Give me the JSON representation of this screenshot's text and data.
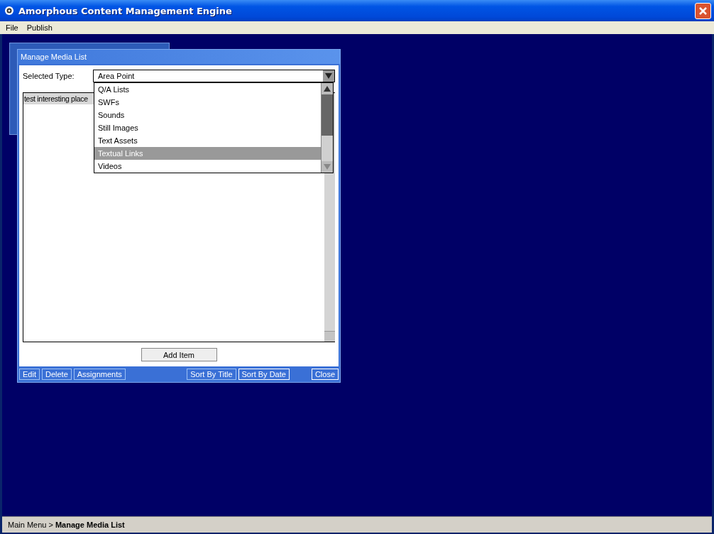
{
  "window": {
    "title": "Amorphous Content Management Engine"
  },
  "menu": [
    "File",
    "Publish"
  ],
  "background_window": {
    "kind": "window"
  },
  "dialog": {
    "title": "Manage Media List",
    "type_label": "Selected Type:",
    "type_value": "Area Point",
    "dropdown_expanded": true,
    "options": [
      {
        "label": "Q/A Lists",
        "selected": false
      },
      {
        "label": "SWFs",
        "selected": false
      },
      {
        "label": "Sounds",
        "selected": false
      },
      {
        "label": "Still Images",
        "selected": false
      },
      {
        "label": "Text Assets",
        "selected": false
      },
      {
        "label": "Textual Links",
        "selected": true
      },
      {
        "label": "Videos",
        "selected": false
      }
    ],
    "items": [
      {
        "title": "test interesting place",
        "selected": true
      }
    ],
    "add_button": "Add Item",
    "left_buttons": [
      "Edit",
      "Delete",
      "Assignments"
    ],
    "right_buttons": [
      "Sort By Title",
      "Sort By Date"
    ],
    "close_button": "Close"
  },
  "status_bar": {
    "path": "Main Menu > **Manage Media List**"
  }
}
